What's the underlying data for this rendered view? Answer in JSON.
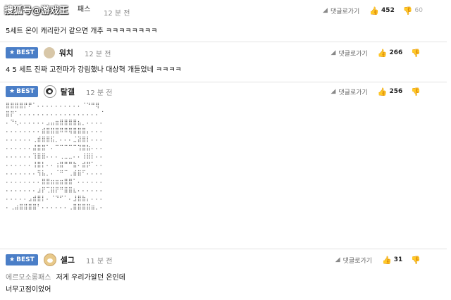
{
  "watermark": "搜狐号@游戏王",
  "labels": {
    "best": "BEST",
    "reply": "댓글로가기"
  },
  "comments": [
    {
      "nick_tail": "패스",
      "time": "12 분 전",
      "up": "452",
      "down": "60",
      "text": "5세트 온이 캐리한거 같으면 개추 ㅋㅋㅋㅋㅋㅋㅋㅋ"
    },
    {
      "badge": "BEST",
      "nick": "워치",
      "time": "12 분 전",
      "up": "266",
      "down": "",
      "text": "4 5 세트 진짜 고전파가 강림했나 대상혁 개들었네 ㅋㅋㅋㅋ"
    },
    {
      "badge": "BEST",
      "nick": "탈갤",
      "time": "12 분 전",
      "up": "256",
      "down": "",
      "art": "⣿⣿⣿⣿⡟⠟⠁⠄⠄⠄⠄⠄⠄⠄⠄⠄⠄⠈⠙⠛⢿\n⣿⡟⠁⠄⠄⠄⠄⠄⠄⠄⠄⠄⠄⠄⠄⠄⠄⠄⠄⠄⠄⠈\n⠄⠙⢆⠄⠄⠄⠄⠄⠄⣠⣤⣶⣿⣿⣿⣿⣦⡀⠄⠄⠄⠄\n⠄⠄⠄⠄⠄⠄⠄⠄⣾⣿⣿⣿⠿⠿⢿⣿⣿⣿⡄⠄⠄⠄\n⠄⠄⠄⠄⠄⠄⢀⣾⣿⣿⣯⡀⠄⠄⠄⣈⣽⣿⡇⠄⠄⠄\n⠄⠄⠄⠄⠄⠄⣼⣿⣿⠁⠄⠉⠉⠉⠉⠉⢹⣿⣷⠄⠄⠄\n⠄⠄⠄⠄⠄⠄⢹⣿⣿⠄⠄⠄⢀⣀⣀⠄⠄⢸⣿⡇⠄⠄\n⠄⠄⠄⠄⠄⠄⢸⣿⡇⠄⠄⢰⣿⠛⠛⣷⠄⣾⡿⠁⠄⠄\n⠄⠄⠄⠄⠄⠄⠄⢻⣧⡀⠄⠈⠛⠉⢀⣾⣿⠋⠄⠄⠄⠄\n⠄⠄⠄⠄⠄⠄⠄⠄⣿⣿⣶⣶⣶⣿⣿⠁⠄⠄⠄⠄⠄⠄\n⠄⠄⠄⠄⠄⠄⠄⣰⡟⢉⣿⡟⠛⣿⣿⣆⠄⠄⠄⠄⠄⠄\n⠄⠄⠄⠄⠄⣠⣾⣿⡇⠄⠈⠙⠋⠁⠄⣸⣿⣷⡄⠄⠄⠄\n⠄⢀⣴⣿⣿⣿⣿⠃⠄⠄⠄⠄⠄⠄⢀⣿⣿⣿⣿⣶⡀⠄"
    },
    {
      "badge": "BEST",
      "nick": "셀그",
      "time": "11 분 전",
      "up": "31",
      "down": "",
      "quote_ref": "에르모소롱패스",
      "quote_body": "저게 우리가알던 온인데",
      "text": "너무고점이었어"
    }
  ]
}
